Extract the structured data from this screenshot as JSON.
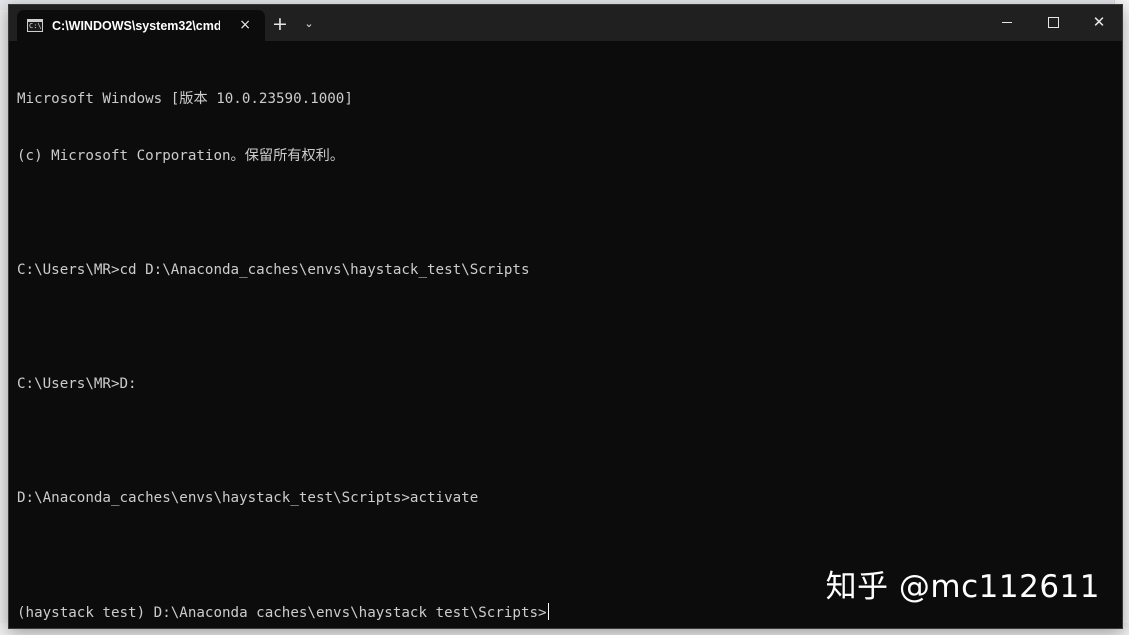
{
  "window": {
    "tab_title": "C:\\WINDOWS\\system32\\cmd.",
    "tab_icon_text": "C:\\",
    "tab_close": "×",
    "new_tab": "+",
    "dropdown": "⌄",
    "close": "✕"
  },
  "console": {
    "lines": [
      "Microsoft Windows [版本 10.0.23590.1000]",
      "(c) Microsoft Corporation。保留所有权利。",
      "",
      "C:\\Users\\MR>cd D:\\Anaconda_caches\\envs\\haystack_test\\Scripts",
      "",
      "C:\\Users\\MR>D:",
      "",
      "D:\\Anaconda_caches\\envs\\haystack_test\\Scripts>activate",
      "",
      "(haystack_test) D:\\Anaconda_caches\\envs\\haystack_test\\Scripts>"
    ]
  },
  "watermark": "知乎 @mc112611",
  "colors": {
    "terminal_bg": "#0c0c0c",
    "titlebar_bg": "#202020",
    "text": "#cccccc"
  }
}
